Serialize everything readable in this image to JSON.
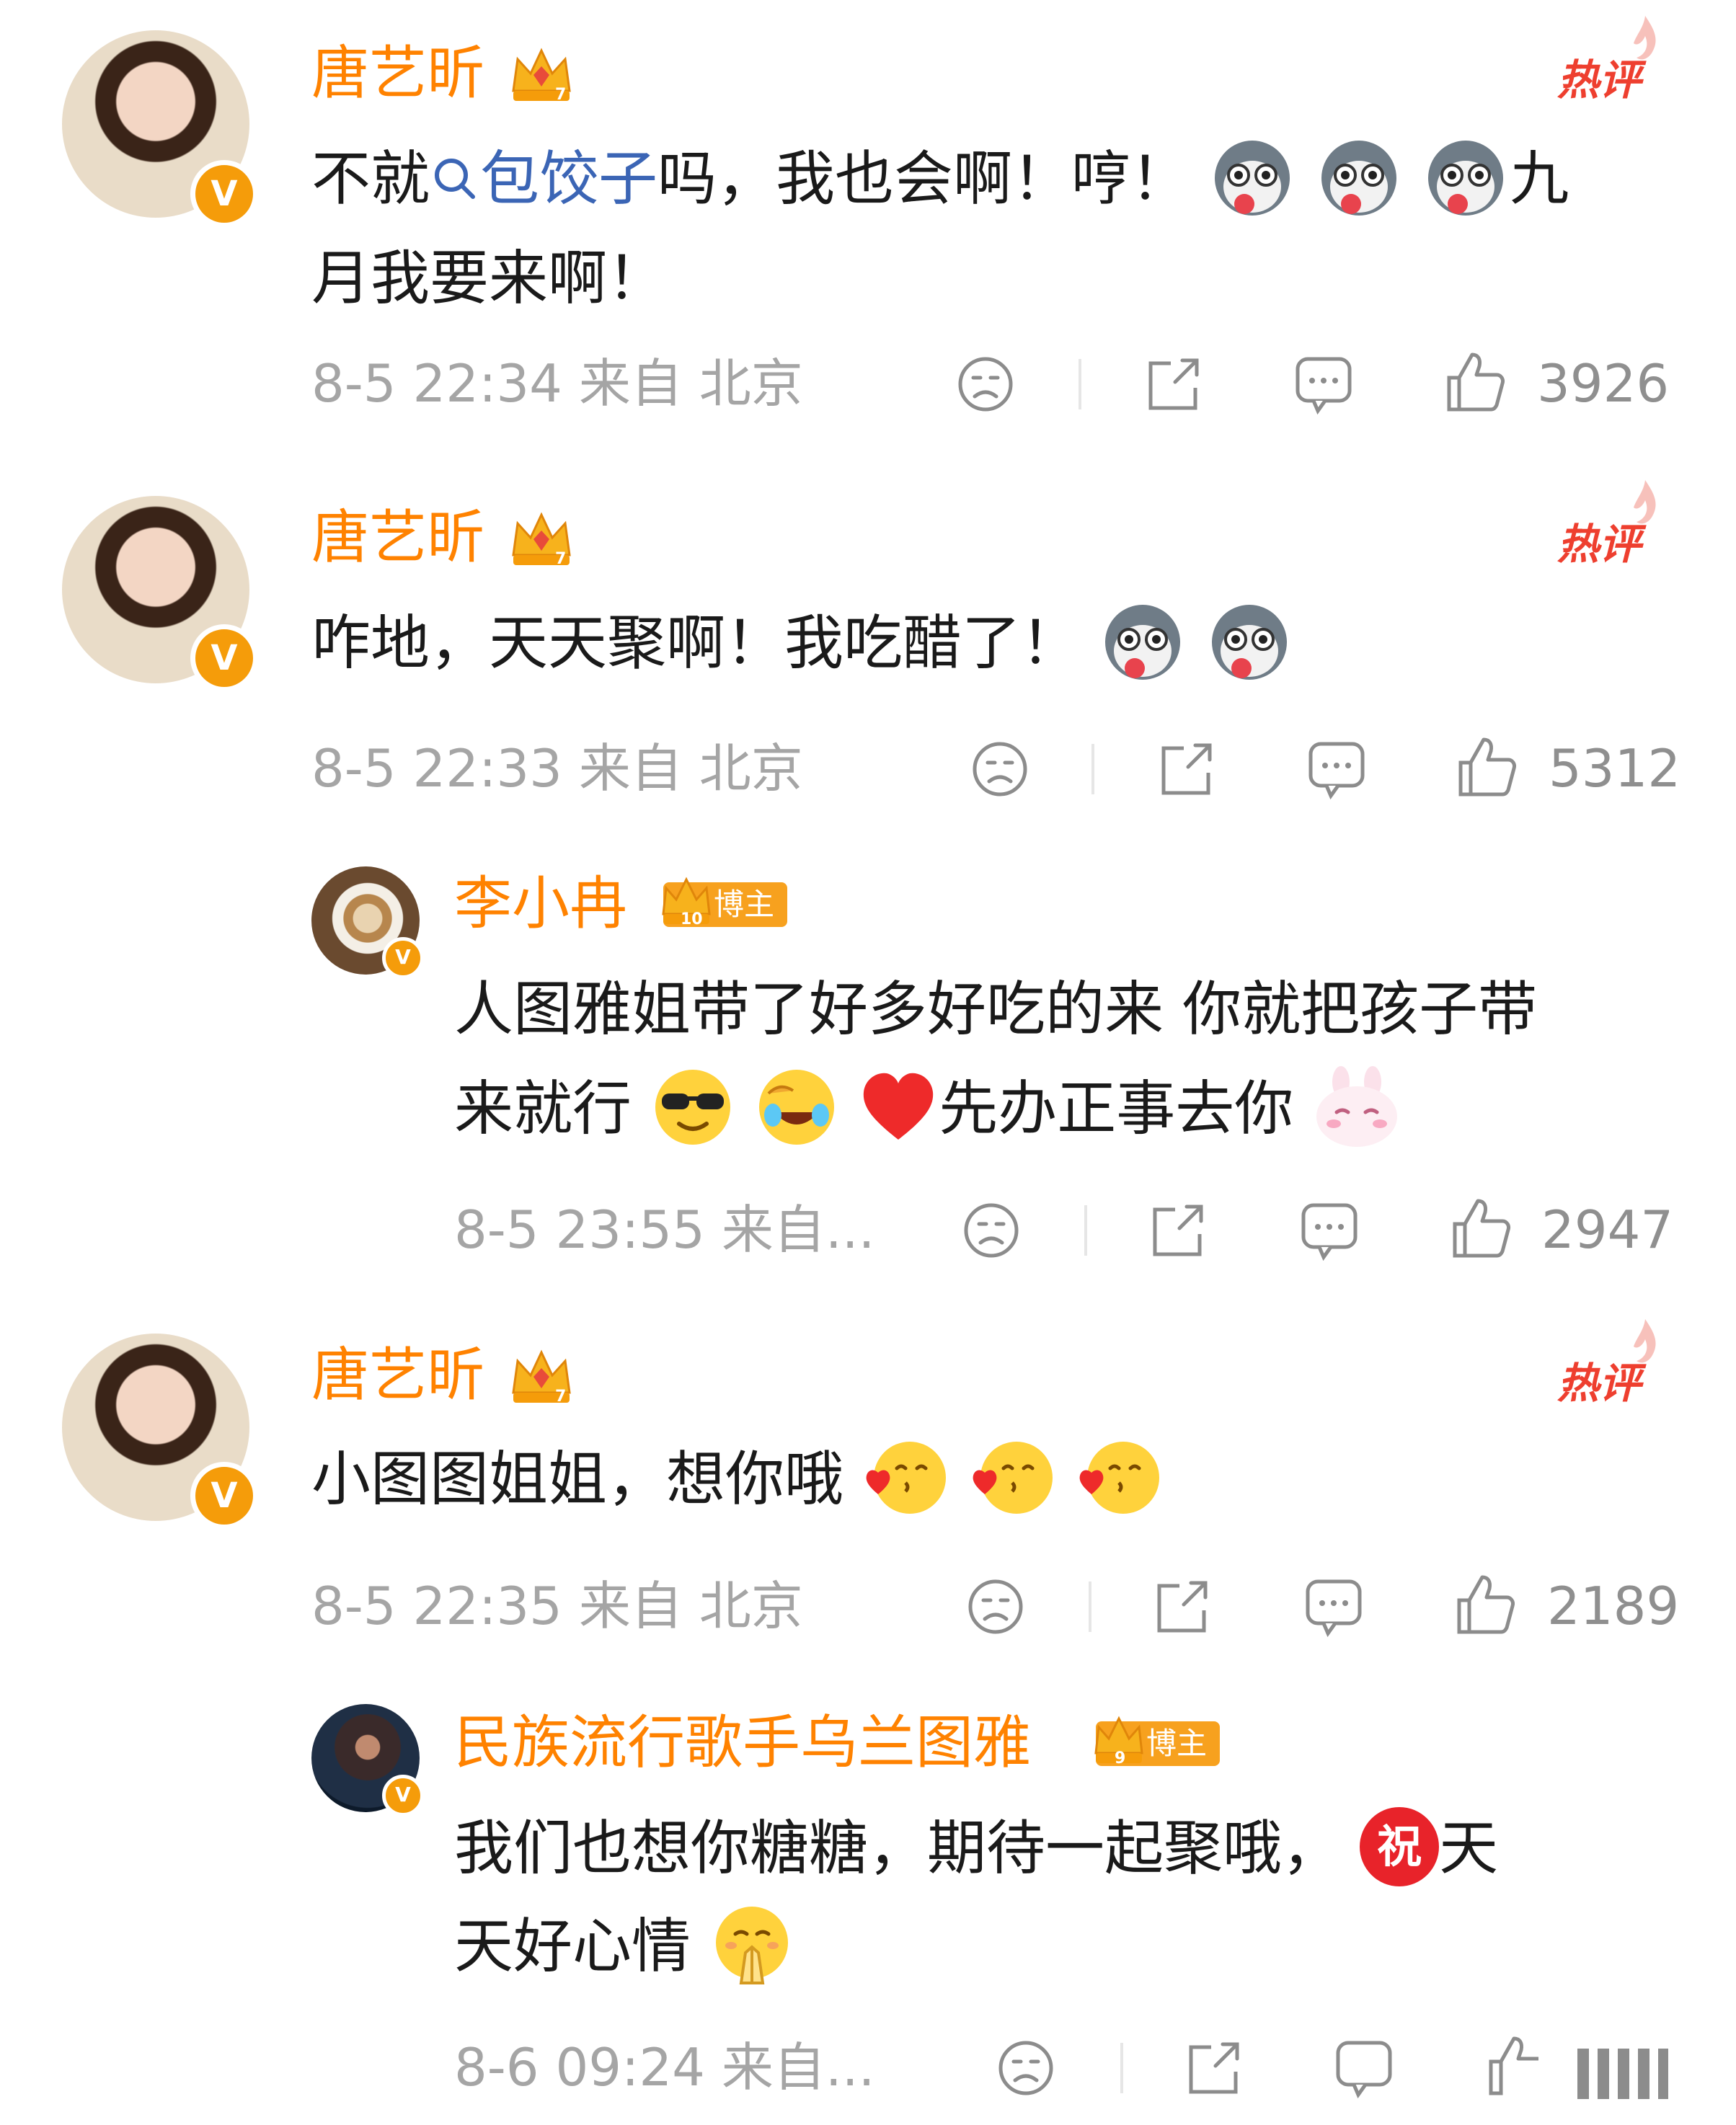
{
  "colors": {
    "username": "#ff8200",
    "link": "#3b65b5",
    "hot": "#ee3f2f",
    "meta": "#a5a5a5",
    "badge": "#f59c0a"
  },
  "comments": [
    {
      "username": "唐艺昕",
      "hot_label": "热评",
      "text_line1_prefix": "不就",
      "topic": "包饺子",
      "text_line1_suffix": "吗，我也会啊！哼！",
      "text_line1_tail": "九",
      "text_line2": "月我要来啊！",
      "time": "8-5 22:34 来自 北京",
      "likes": "3926"
    },
    {
      "username": "唐艺昕",
      "hot_label": "热评",
      "text_line1": "咋地，天天聚啊！我吃醋了！",
      "time": "8-5 22:33 来自 北京",
      "likes": "5312",
      "reply": {
        "username": "李小冉",
        "badge_label": "博主",
        "badge_level": "10",
        "text_line1": "人图雅姐带了好多好吃的来 你就把孩子带",
        "text_line2_prefix": "来就行",
        "text_line2_suffix": "先办正事去你",
        "time": "8-5 23:55 来自...",
        "likes": "2947"
      }
    },
    {
      "username": "唐艺昕",
      "hot_label": "热评",
      "text_line1": "小图图姐姐，想你哦",
      "time": "8-5 22:35 来自 北京",
      "likes": "2189",
      "reply": {
        "username": "民族流行歌手乌兰图雅",
        "badge_label": "博主",
        "badge_level": "9",
        "text_line1_prefix": "我们也想你糖糖，期待一起聚哦，",
        "text_line1_tail": "天",
        "text_line2": "天好心情",
        "time": "8-6 09:24 来自..."
      }
    }
  ],
  "icons": {
    "verified": "V",
    "dislike": "dislike-icon",
    "share": "share-icon",
    "comment": "comment-icon",
    "like": "like-icon",
    "wish": "祝"
  }
}
